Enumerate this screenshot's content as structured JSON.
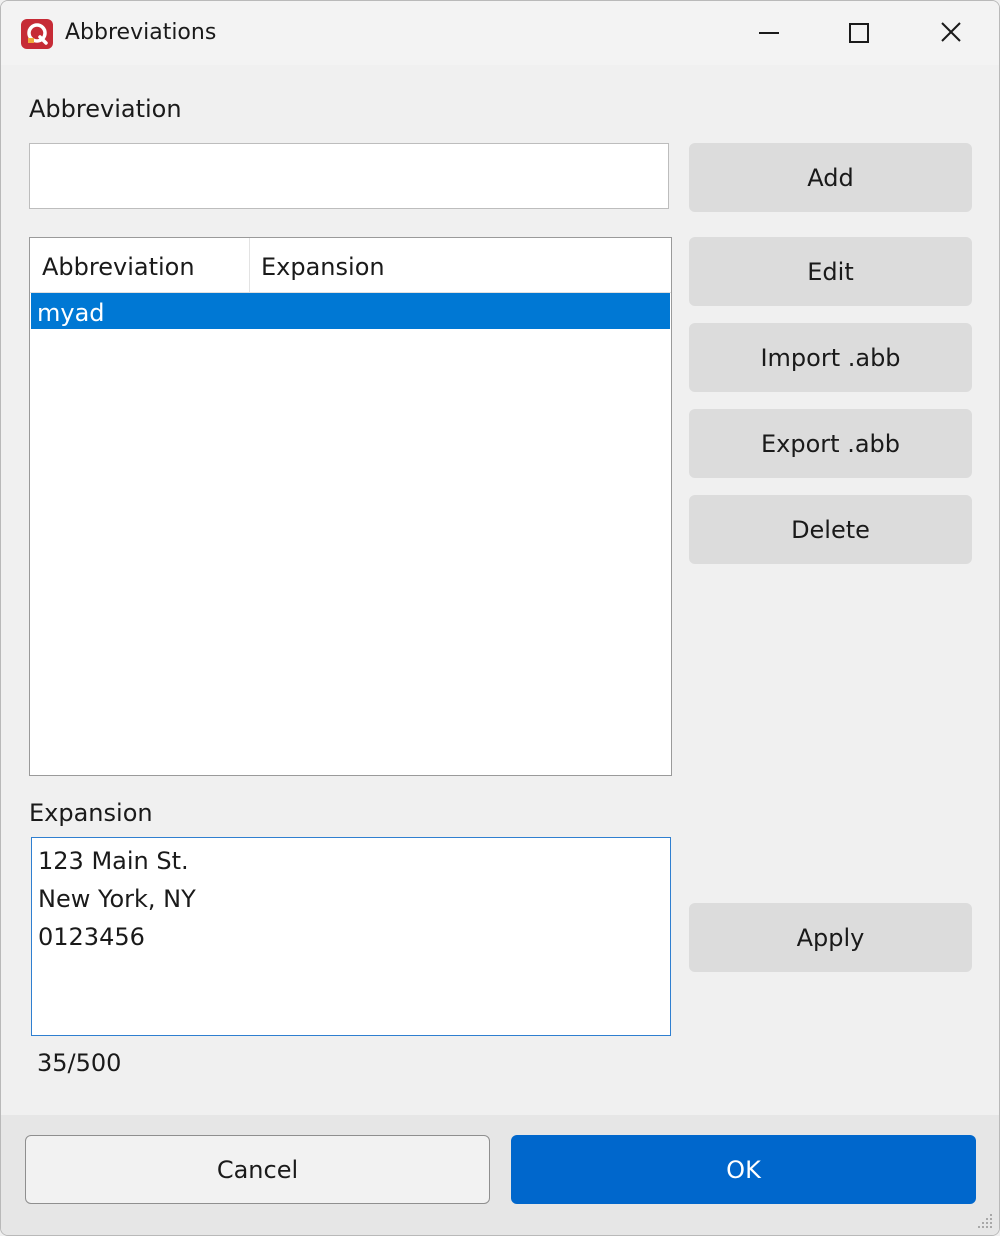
{
  "window": {
    "title": "Abbreviations",
    "accent": "#0078d4",
    "icon": "app-logo-icon"
  },
  "title_controls": {
    "minimize": "minimize-icon",
    "maximize": "maximize-icon",
    "close": "close-icon"
  },
  "abbreviation": {
    "label": "Abbreviation",
    "value": ""
  },
  "list": {
    "columns": [
      "Abbreviation",
      "Expansion"
    ],
    "rows": [
      {
        "abbreviation": "myad",
        "expansion": "",
        "selected": true
      }
    ]
  },
  "buttons": {
    "add": "Add",
    "edit": "Edit",
    "import": "Import .abb",
    "export": "Export .abb",
    "delete": "Delete",
    "apply": "Apply"
  },
  "expansion": {
    "label": "Expansion",
    "value": "123 Main St.\nNew York, NY\n0123456",
    "counter": "35/500"
  },
  "footer": {
    "cancel": "Cancel",
    "ok": "OK"
  }
}
